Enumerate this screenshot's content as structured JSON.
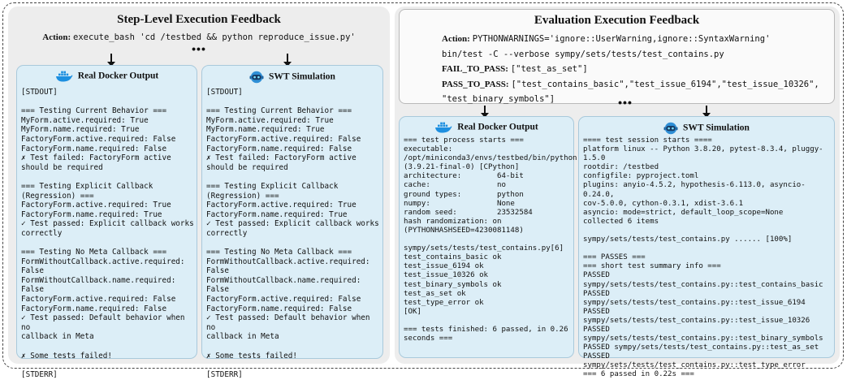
{
  "left": {
    "title": "Step-Level Execution Feedback",
    "action_label": "Action:",
    "action_value": "execute_bash 'cd /testbed && python reproduce_issue.py'",
    "ellipsis": "•••",
    "docker": {
      "title": "Real Docker Output",
      "icon": "docker-whale-icon",
      "output": "[STDOUT]\n\n=== Testing Current Behavior ===\nMyForm.active.required: True\nMyForm.name.required: True\nFactoryForm.active.required: False\nFactoryForm.name.required: False\n✗ Test failed: FactoryForm active\nshould be required\n\n=== Testing Explicit Callback\n(Regression) ===\nFactoryForm.active.required: True\nFactoryForm.name.required: True\n✓ Test passed: Explicit callback works\ncorrectly\n\n=== Testing No Meta Callback ===\nFormWithoutCallback.active.required:\nFalse\nFormWithoutCallback.name.required: False\nFactoryForm.active.required: False\nFactoryForm.name.required: False\n✓ Test passed: Default behavior when no\ncallback in Meta\n\n✗ Some tests failed!\n\n[STDERR]"
    },
    "swt": {
      "title": "SWT Simulation",
      "icon": "robot-head-icon",
      "output": "[STDOUT]\n\n=== Testing Current Behavior ===\nMyForm.active.required: True\nMyForm.name.required: True\nFactoryForm.active.required: False\nFactoryForm.name.required: False\n✗ Test failed: FactoryForm active\nshould be required\n\n=== Testing Explicit Callback\n(Regression) ===\nFactoryForm.active.required: True\nFactoryForm.name.required: True\n✓ Test passed: Explicit callback works\ncorrectly\n\n=== Testing No Meta Callback ===\nFormWithoutCallback.active.required:\nFalse\nFormWithoutCallback.name.required: False\nFactoryForm.active.required: False\nFactoryForm.name.required: False\n✓ Test passed: Default behavior when no\ncallback in Meta\n\n✗ Some tests failed!\n\n[STDERR]"
    }
  },
  "right": {
    "title": "Evaluation Execution Feedback",
    "action_label": "Action:",
    "action_line1": "PYTHONWARNINGS='ignore::UserWarning,ignore::SyntaxWarning'",
    "action_line2": "bin/test -C --verbose sympy/sets/tests/test_contains.py",
    "fail_label": "FAIL_TO_PASS:",
    "fail_value": "[\"test_as_set\"]",
    "pass_label": "PASS_TO_PASS:",
    "pass_value_line1": "[\"test_contains_basic\",\"test_issue_6194\",\"test_issue_10326\",",
    "pass_value_line2": "\"test_binary_symbols\"]",
    "ellipsis": "•••",
    "docker": {
      "title": "Real Docker Output",
      "icon": "docker-whale-icon",
      "output": "=== test process starts ===\nexecutable:\n/opt/miniconda3/envs/testbed/bin/python\n(3.9.21-final-0) [CPython]\narchitecture:        64-bit\ncache:               no\nground types:        python\nnumpy:               None\nrandom seed:         23532584\nhash randomization: on\n(PYTHONHASHSEED=4230081148)\n\nsympy/sets/tests/test_contains.py[6]\ntest_contains_basic ok\ntest_issue_6194 ok\ntest_issue_10326 ok\ntest_binary_symbols ok\ntest_as_set ok\ntest_type_error ok\n[OK]\n\n=== tests finished: 6 passed, in 0.26\nseconds ==="
    },
    "swt": {
      "title": "SWT Simulation",
      "icon": "robot-head-icon",
      "output": "==== test session starts ====\nplatform linux -- Python 3.8.20, pytest-8.3.4, pluggy-\n1.5.0\nrootdir: /testbed\nconfigfile: pyproject.toml\nplugins: anyio-4.5.2, hypothesis-6.113.0, asyncio-0.24.0,\ncov-5.0.0, cython-0.3.1, xdist-3.6.1\nasyncio: mode=strict, default_loop_scope=None\ncollected 6 items\n\nsympy/sets/tests/test_contains.py ...... [100%]\n\n=== PASSES ===\n=== short test summary info ===\nPASSED\nsympy/sets/tests/test_contains.py::test_contains_basic\nPASSED sympy/sets/tests/test_contains.py::test_issue_6194\nPASSED sympy/sets/tests/test_contains.py::test_issue_10326\nPASSED\nsympy/sets/tests/test_contains.py::test_binary_symbols\nPASSED sympy/sets/tests/test_contains.py::test_as_set\nPASSED sympy/sets/tests/test_contains.py::test_type_error\n=== 6 passed in 0.22s ==="
    }
  }
}
